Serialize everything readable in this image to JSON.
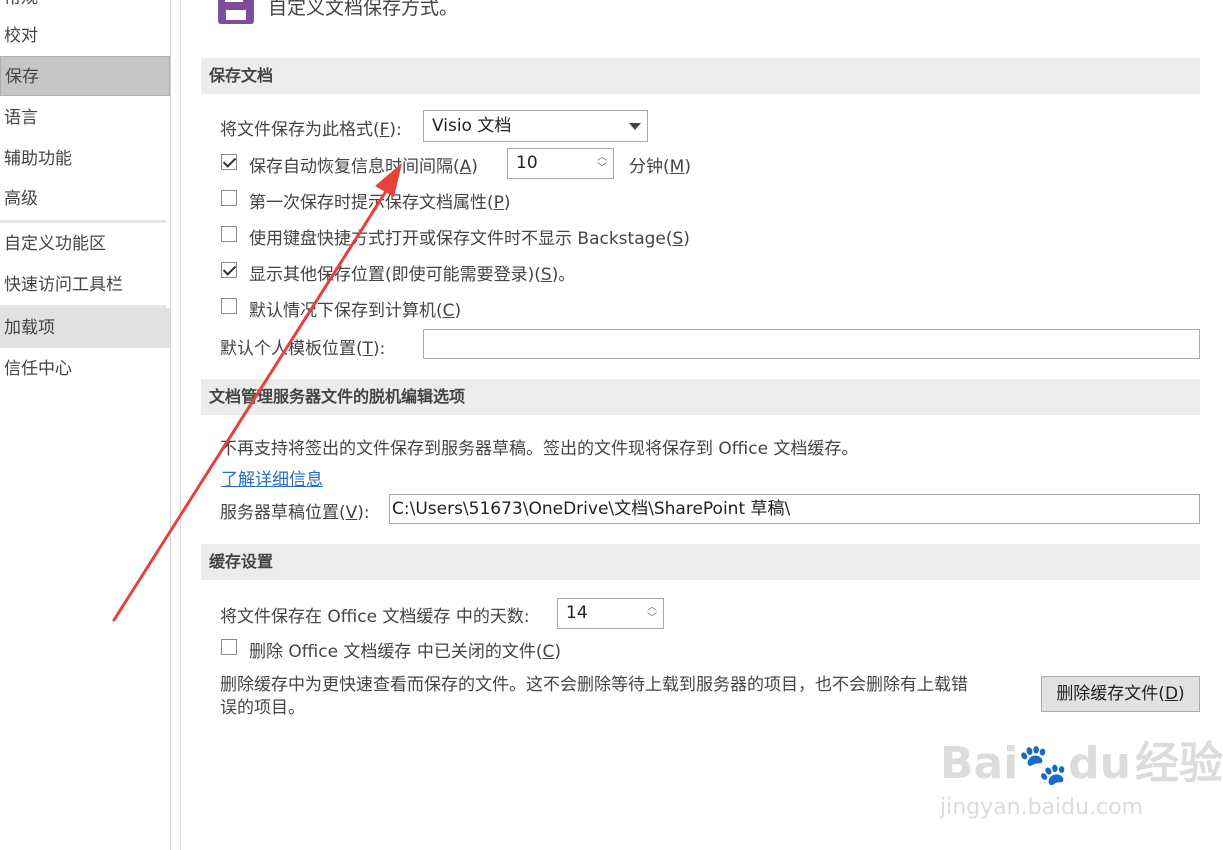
{
  "sidebar": {
    "items": [
      {
        "label": "常规"
      },
      {
        "label": "校对"
      },
      {
        "label": "保存"
      },
      {
        "label": "语言"
      },
      {
        "label": "辅助功能"
      },
      {
        "label": "高级"
      },
      {
        "label": "自定义功能区"
      },
      {
        "label": "快速访问工具栏"
      },
      {
        "label": "加载项"
      },
      {
        "label": "信任中心"
      }
    ]
  },
  "header": {
    "title": "自定义文档保存方式。",
    "icon": "floppy-disk-icon",
    "icon_color": "#7b4f9d"
  },
  "save_docs": {
    "section_title": "保存文档",
    "format_label": "将文件保存为此格式(",
    "format_key": "F",
    "format_suffix": "):",
    "format_value": "Visio 文档",
    "autorecover_label": "保存自动恢复信息时间间隔(",
    "autorecover_key": "A",
    "autorecover_suffix": ")",
    "autorecover_checked": true,
    "autorecover_minutes": "10",
    "minutes_label": "分钟(",
    "minutes_key": "M",
    "minutes_suffix": ")",
    "prompt_props_label": "第一次保存时提示保存文档属性(",
    "prompt_props_key": "P",
    "prompt_props_suffix": ")",
    "prompt_props_checked": false,
    "no_backstage_label": "使用键盘快捷方式打开或保存文件时不显示 Backstage(",
    "no_backstage_key": "S",
    "no_backstage_suffix": ")",
    "no_backstage_checked": false,
    "show_locations_label": "显示其他保存位置(即使可能需要登录)(",
    "show_locations_key": "S",
    "show_locations_suffix": ")。",
    "show_locations_checked": true,
    "save_to_computer_label": "默认情况下保存到计算机(",
    "save_to_computer_key": "C",
    "save_to_computer_suffix": ")",
    "save_to_computer_checked": false,
    "template_location_label": "默认个人模板位置(",
    "template_location_key": "T",
    "template_location_suffix": "):",
    "template_location_value": ""
  },
  "offline": {
    "section_title": "文档管理服务器文件的脱机编辑选项",
    "notice": "不再支持将签出的文件保存到服务器草稿。签出的文件现将保存到 Office 文档缓存。",
    "learn_more": "了解详细信息",
    "drafts_label": "服务器草稿位置(",
    "drafts_key": "V",
    "drafts_suffix": "):",
    "drafts_value": "C:\\Users\\51673\\OneDrive\\文档\\SharePoint 草稿\\"
  },
  "cache": {
    "section_title": "缓存设置",
    "days_label": "将文件保存在 Office 文档缓存 中的天数:",
    "days_value": "14",
    "delete_closed_label": "删除 Office 文档缓存 中已关闭的文件(",
    "delete_closed_key": "C",
    "delete_closed_suffix": ")",
    "delete_closed_checked": false,
    "description_line1": "删除缓存中为更快速查看而保存的文件。这不会删除等待上载到服务器的项目，也不会删除有上载错",
    "description_line2": "误的项目。",
    "delete_button_label": "删除缓存文件(",
    "delete_button_key": "D",
    "delete_button_suffix": ")"
  },
  "annotation": {
    "arrow_color": "#e8403a"
  },
  "watermark": {
    "brand_a": "Bai",
    "brand_b": "du",
    "brand_c": "经验",
    "url": "jingyan.baidu.com"
  }
}
